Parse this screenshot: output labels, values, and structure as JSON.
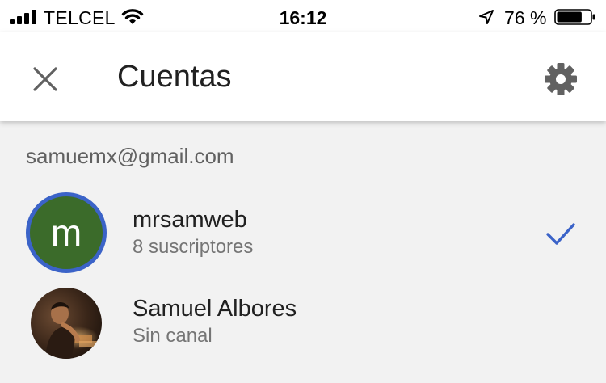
{
  "status_bar": {
    "carrier": "TELCEL",
    "time": "16:12",
    "battery_percent": "76 %",
    "battery_level": 0.76
  },
  "header": {
    "title": "Cuentas"
  },
  "account": {
    "email": "samuemx@gmail.com"
  },
  "channels": [
    {
      "name": "mrsamweb",
      "subtitle": "8 suscriptores",
      "avatar_letter": "m",
      "selected": true,
      "avatar_color": "#3b6b2a",
      "ring_color": "#3b63c8"
    },
    {
      "name": "Samuel Albores",
      "subtitle": "Sin canal",
      "selected": false
    }
  ],
  "colors": {
    "accent": "#3b63c8",
    "background": "#f2f2f2",
    "appbar": "#ffffff"
  }
}
